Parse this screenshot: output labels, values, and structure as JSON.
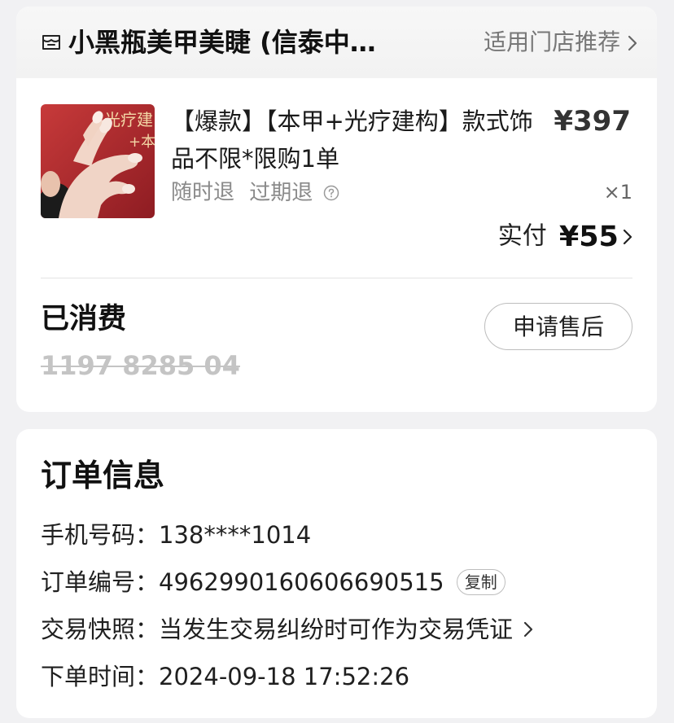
{
  "store": {
    "name": "小黑瓶美甲美睫 (信泰中…",
    "recommend_link": "适用门店推荐",
    "icon": "store-icon"
  },
  "product": {
    "title": "【爆款】【本甲+光疗建构】款式饰品不限*限购1单",
    "price": "¥397",
    "refund_tags": [
      "随时退",
      "过期退"
    ],
    "quantity": "×1",
    "paid_label": "实付",
    "paid_amount": "¥55",
    "thumbnail_icon": "nail-product-image",
    "thumbnail_text": "光疗建 +本"
  },
  "status": {
    "label": "已消费",
    "voucher_code": "1197 8285 04",
    "after_sale_button": "申请售后"
  },
  "order_info": {
    "title": "订单信息",
    "phone_label": "手机号码：",
    "phone_value": "138****1014",
    "order_no_label": "订单编号：",
    "order_no_value": "4962990160606690515",
    "copy_button": "复制",
    "snapshot_label": "交易快照：",
    "snapshot_value": "当发生交易纠纷时可作为交易凭证",
    "time_label": "下单时间：",
    "time_value": "2024-09-18 17:52:26"
  },
  "colors": {
    "background": "#f1f1f3",
    "card": "#ffffff",
    "text_primary": "#1a1a1a",
    "text_secondary": "#8a8a8a",
    "thumbnail_red": "#b3262a"
  }
}
